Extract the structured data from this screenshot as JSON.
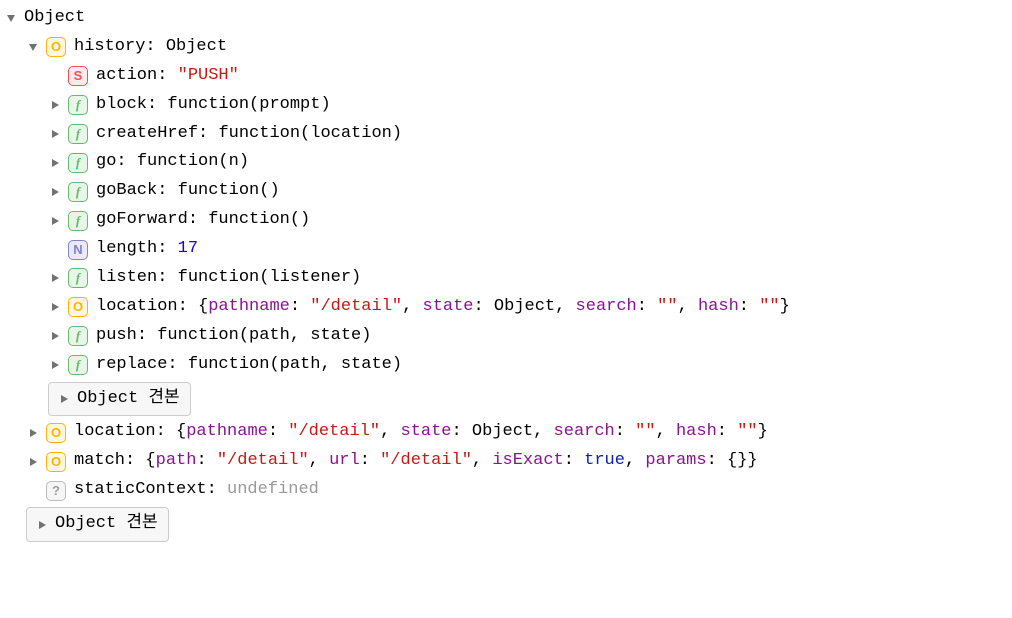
{
  "root": {
    "label": "Object"
  },
  "history": {
    "key": "history",
    "type_label": "Object",
    "action": {
      "key": "action",
      "value": "\"PUSH\""
    },
    "block": {
      "key": "block",
      "sig": "function(prompt)"
    },
    "createHref": {
      "key": "createHref",
      "sig": "function(location)"
    },
    "go": {
      "key": "go",
      "sig": "function(n)"
    },
    "goBack": {
      "key": "goBack",
      "sig": "function()"
    },
    "goForward": {
      "key": "goForward",
      "sig": "function()"
    },
    "length": {
      "key": "length",
      "value": "17"
    },
    "listen": {
      "key": "listen",
      "sig": "function(listener)"
    },
    "location": {
      "key": "location",
      "pathname_k": "pathname",
      "pathname_v": "\"/detail\"",
      "state_k": "state",
      "state_v": "Object",
      "search_k": "search",
      "search_v": "\"\"",
      "hash_k": "hash",
      "hash_v": "\"\""
    },
    "push": {
      "key": "push",
      "sig": "function(path, state)"
    },
    "replace": {
      "key": "replace",
      "sig": "function(path, state)"
    },
    "proto_label": "Object 견본"
  },
  "location": {
    "key": "location",
    "pathname_k": "pathname",
    "pathname_v": "\"/detail\"",
    "state_k": "state",
    "state_v": "Object",
    "search_k": "search",
    "search_v": "\"\"",
    "hash_k": "hash",
    "hash_v": "\"\""
  },
  "match": {
    "key": "match",
    "path_k": "path",
    "path_v": "\"/detail\"",
    "url_k": "url",
    "url_v": "\"/detail\"",
    "isExact_k": "isExact",
    "isExact_v": "true",
    "params_k": "params",
    "params_v": "{}"
  },
  "staticContext": {
    "key": "staticContext",
    "value": "undefined"
  },
  "proto_label": "Object 견본"
}
